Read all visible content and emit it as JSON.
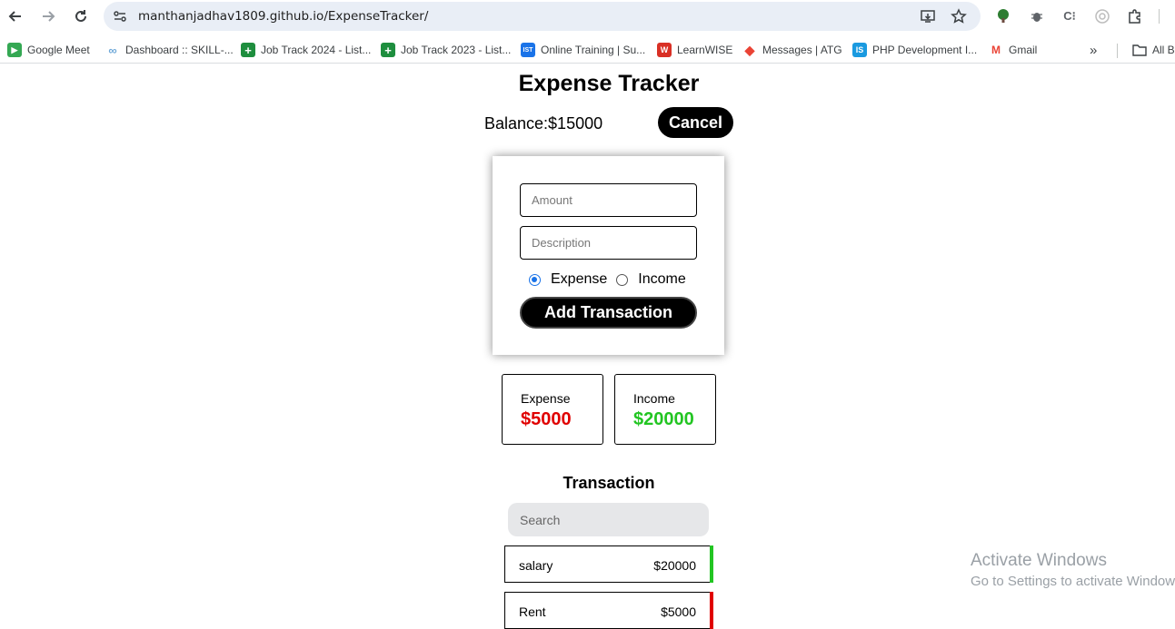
{
  "browser": {
    "url": "manthanjadhav1809.github.io/ExpenseTracker/",
    "bookmarks": [
      {
        "label": "Google Meet",
        "color": "#34a853",
        "glyph": "▶"
      },
      {
        "label": "Dashboard :: SKILL-...",
        "color": "#6ea8d8",
        "glyph": "∞"
      },
      {
        "label": "Job Track 2024 - List...",
        "color": "#1e8e3e",
        "glyph": "+"
      },
      {
        "label": "Job Track 2023 - List...",
        "color": "#1e8e3e",
        "glyph": "+"
      },
      {
        "label": "Online Training | Su...",
        "color": "#1a73e8",
        "glyph": "IST"
      },
      {
        "label": "LearnWISE",
        "color": "#d93025",
        "glyph": "W"
      },
      {
        "label": "Messages | ATG",
        "color": "#ea4335",
        "glyph": "◆"
      },
      {
        "label": "PHP Development I...",
        "color": "#1a9ae0",
        "glyph": "IS"
      },
      {
        "label": "Gmail",
        "color": "#ea4335",
        "glyph": "M"
      }
    ],
    "all_bookmarks_label": "All B"
  },
  "app": {
    "title": "Expense Tracker",
    "balance_text": "Balance:$15000",
    "cancel_label": "Cancel",
    "form": {
      "amount_placeholder": "Amount",
      "description_placeholder": "Description",
      "type_options": [
        "Expense",
        "Income"
      ],
      "selected_type": "Expense",
      "submit_label": "Add Transaction"
    },
    "summary": {
      "expense": {
        "label": "Expense",
        "value": "$5000",
        "color": "#e00000"
      },
      "income": {
        "label": "Income",
        "value": "$20000",
        "color": "#22c522"
      }
    },
    "transactions_title": "Transaction",
    "search_placeholder": "Search",
    "transactions": [
      {
        "desc": "salary",
        "amount": "$20000",
        "type": "income",
        "color": "#22c522"
      },
      {
        "desc": "Rent",
        "amount": "$5000",
        "type": "expense",
        "color": "#e00000"
      }
    ]
  },
  "os": {
    "watermark_title": "Activate Windows",
    "watermark_sub": "Go to Settings to activate Windows."
  }
}
